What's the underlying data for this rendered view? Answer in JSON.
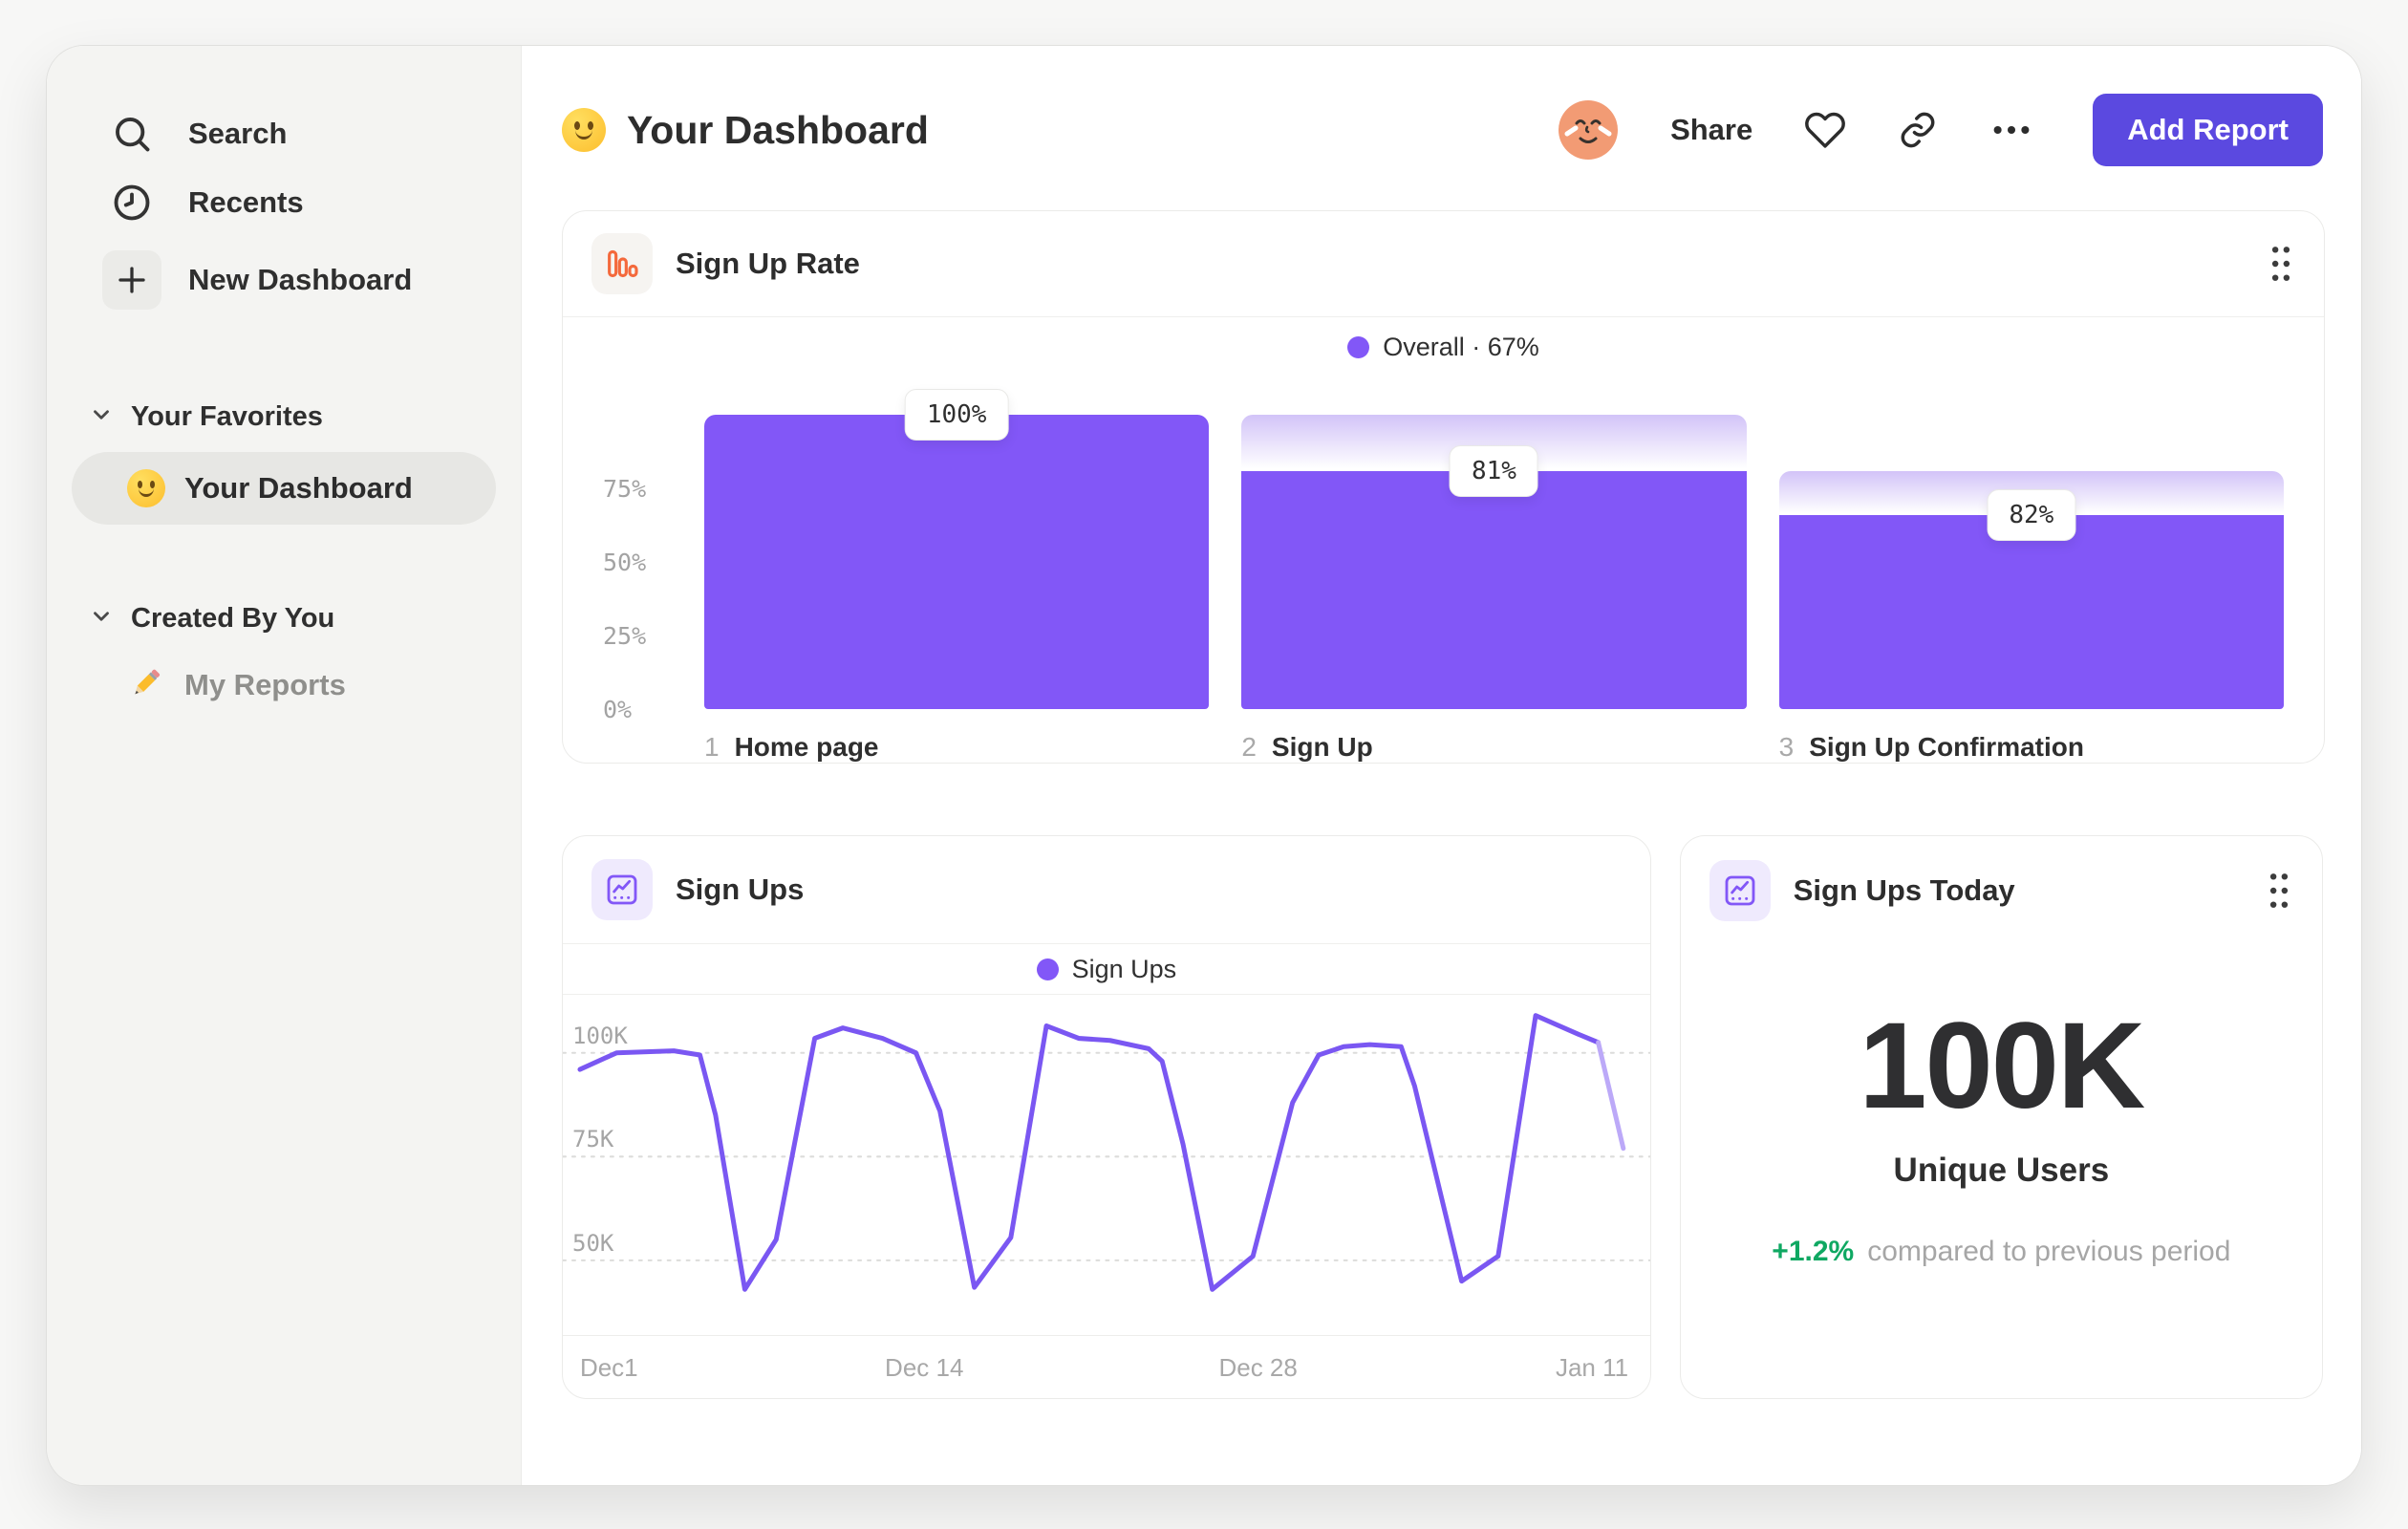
{
  "colors": {
    "accent_purple": "#8257F7",
    "line_purple": "#7A57F2",
    "line_faded": "#BCA9F8",
    "gradient_top": "#D2C3F8",
    "button_purple": "#5B49E0",
    "icon_orange": "#F4693C",
    "delta_green": "#0FA862"
  },
  "sidebar": {
    "search_label": "Search",
    "recents_label": "Recents",
    "new_dashboard_label": "New Dashboard",
    "favorites_header": "Your Favorites",
    "favorite_item": "Your Dashboard",
    "created_header": "Created By You",
    "reports_item": "My Reports"
  },
  "header": {
    "title": "Your Dashboard",
    "share_label": "Share",
    "add_report_label": "Add Report"
  },
  "funnel_card": {
    "title": "Sign Up Rate",
    "legend_label": "Overall",
    "legend_sep": "·",
    "legend_value": "67%"
  },
  "line_card": {
    "title": "Sign Ups",
    "legend_label": "Sign Ups"
  },
  "metric_card": {
    "title": "Sign Ups Today",
    "value": "100K",
    "unit_label": "Unique Users",
    "delta": "+1.2%",
    "delta_description": "compared to previous period"
  },
  "chart_data": [
    {
      "type": "bar",
      "variant": "funnel",
      "title": "Sign Up Rate",
      "legend": "Overall · 67%",
      "overall_conversion_pct": 67,
      "ylim": [
        0,
        100
      ],
      "y_ticks": [
        {
          "label": "75%",
          "value": 75
        },
        {
          "label": "50%",
          "value": 50
        },
        {
          "label": "25%",
          "value": 25
        },
        {
          "label": "0%",
          "value": 0
        }
      ],
      "steps": [
        {
          "index": "1",
          "label": "Home page",
          "badge": "100%",
          "overall_pct": 100,
          "prev_overall_pct": 100,
          "step_conversion_pct": 100
        },
        {
          "index": "2",
          "label": "Sign Up",
          "badge": "81%",
          "overall_pct": 81,
          "prev_overall_pct": 100,
          "step_conversion_pct": 81
        },
        {
          "index": "3",
          "label": "Sign Up Confirmation",
          "badge": "82%",
          "overall_pct": 66,
          "prev_overall_pct": 81,
          "step_conversion_pct": 82
        }
      ]
    },
    {
      "type": "line",
      "title": "Sign Ups",
      "legend": "Sign Ups",
      "grid": "dotted-horizontal",
      "y_domain_k": [
        32,
        114
      ],
      "y_gridlines": [
        {
          "label": "100K",
          "value_k": 100
        },
        {
          "label": "75K",
          "value_k": 75
        },
        {
          "label": "50K",
          "value_k": 50
        }
      ],
      "x_ticks": [
        {
          "label": "Dec1",
          "pos": 0
        },
        {
          "label": "Dec 14",
          "pos": 0.33
        },
        {
          "label": "Dec 28",
          "pos": 0.65
        },
        {
          "label": "Jan 11",
          "pos": 0.97
        }
      ],
      "points_x_norm_y_thousands": [
        [
          0.0,
          96
        ],
        [
          0.035,
          100
        ],
        [
          0.09,
          100.5
        ],
        [
          0.115,
          99.5
        ],
        [
          0.13,
          85
        ],
        [
          0.158,
          43
        ],
        [
          0.188,
          55
        ],
        [
          0.225,
          103.5
        ],
        [
          0.252,
          106
        ],
        [
          0.29,
          103.5
        ],
        [
          0.322,
          100
        ],
        [
          0.345,
          86
        ],
        [
          0.378,
          43.5
        ],
        [
          0.413,
          55.5
        ],
        [
          0.447,
          106.5
        ],
        [
          0.478,
          103.5
        ],
        [
          0.508,
          103
        ],
        [
          0.545,
          101
        ],
        [
          0.558,
          98
        ],
        [
          0.578,
          78
        ],
        [
          0.606,
          43
        ],
        [
          0.645,
          51
        ],
        [
          0.683,
          88
        ],
        [
          0.708,
          99.5
        ],
        [
          0.732,
          101.5
        ],
        [
          0.757,
          102
        ],
        [
          0.787,
          101.5
        ],
        [
          0.8,
          92
        ],
        [
          0.845,
          45
        ],
        [
          0.88,
          51
        ],
        [
          0.916,
          109
        ],
        [
          0.957,
          104.5
        ],
        [
          0.976,
          102.5
        ],
        [
          1.0,
          77
        ]
      ],
      "final_segment_faded": true
    }
  ]
}
